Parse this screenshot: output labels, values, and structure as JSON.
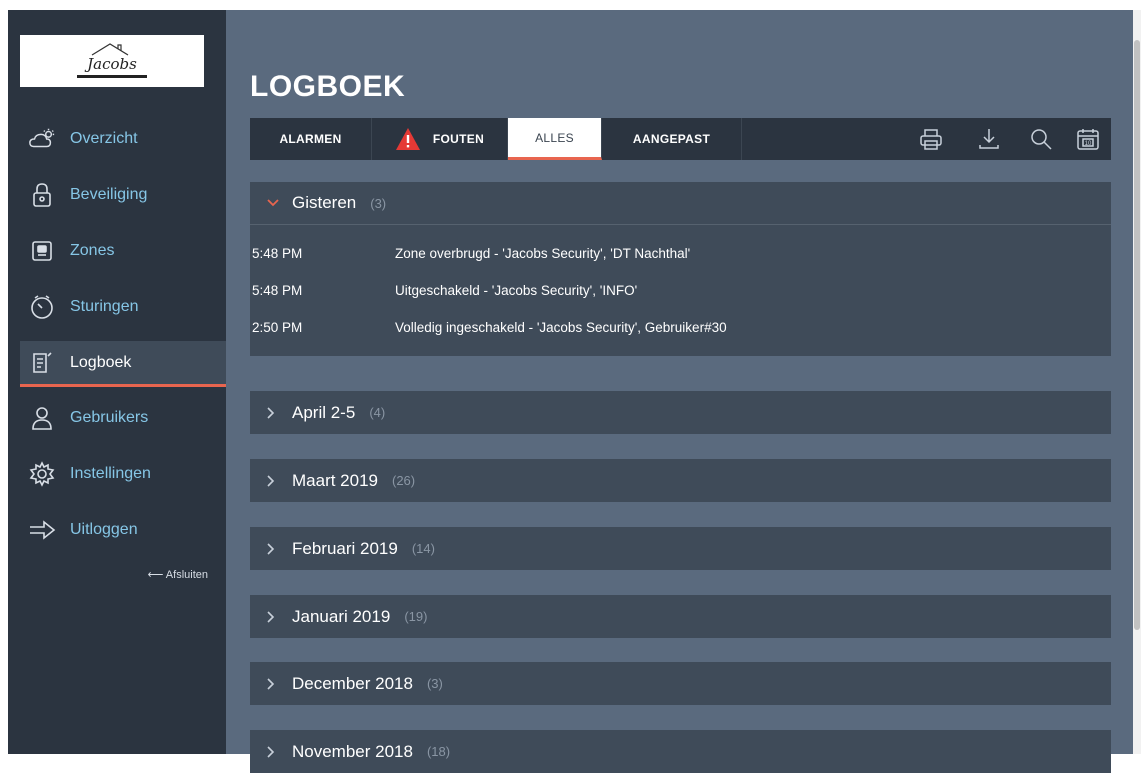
{
  "logo": {
    "brand": "Jacobs"
  },
  "nav": {
    "items": [
      {
        "label": "Overzicht",
        "icon": "cloud-sun-icon"
      },
      {
        "label": "Beveiliging",
        "icon": "lock-icon"
      },
      {
        "label": "Zones",
        "icon": "zone-icon"
      },
      {
        "label": "Sturingen",
        "icon": "timer-icon"
      },
      {
        "label": "Logboek",
        "icon": "logbook-icon"
      },
      {
        "label": "Gebruikers",
        "icon": "user-icon"
      },
      {
        "label": "Instellingen",
        "icon": "gear-icon"
      },
      {
        "label": "Uitloggen",
        "icon": "logout-arrow-icon"
      }
    ],
    "active": "Logboek",
    "close_label": "⟵ Afsluiten"
  },
  "page": {
    "title": "LOGBOEK"
  },
  "tabs": {
    "alarmen": "ALARMEN",
    "fouten": "FOUTEN",
    "alles": "ALLES",
    "aangepast": "AANGEPAST",
    "active": "ALLES"
  },
  "toolbar": {
    "icons": [
      "print-icon",
      "download-icon",
      "search-icon",
      "calendar-icon"
    ],
    "calendar_day": "10"
  },
  "groups": [
    {
      "label": "Gisteren",
      "count": "(3)",
      "expanded": true,
      "entries": [
        {
          "time": "5:48 PM",
          "text": "Zone overbrugd - 'Jacobs Security', 'DT Nachthal'"
        },
        {
          "time": "5:48 PM",
          "text": "Uitgeschakeld - 'Jacobs Security', 'INFO'"
        },
        {
          "time": "2:50 PM",
          "text": "Volledig ingeschakeld - 'Jacobs Security', Gebruiker#30"
        }
      ]
    },
    {
      "label": "April 2-5",
      "count": "(4)",
      "expanded": false
    },
    {
      "label": "Maart 2019",
      "count": "(26)",
      "expanded": false
    },
    {
      "label": "Februari 2019",
      "count": "(14)",
      "expanded": false
    },
    {
      "label": "Januari 2019",
      "count": "(19)",
      "expanded": false
    },
    {
      "label": "December 2018",
      "count": "(3)",
      "expanded": false
    },
    {
      "label": "November 2018",
      "count": "(18)",
      "expanded": false
    }
  ],
  "colors": {
    "accent": "#e8654f",
    "sidebar": "#2b3440",
    "main": "#5a6a7e",
    "panel": "#3f4b59",
    "nav_text": "#86c6e6",
    "warning": "#e53935"
  }
}
